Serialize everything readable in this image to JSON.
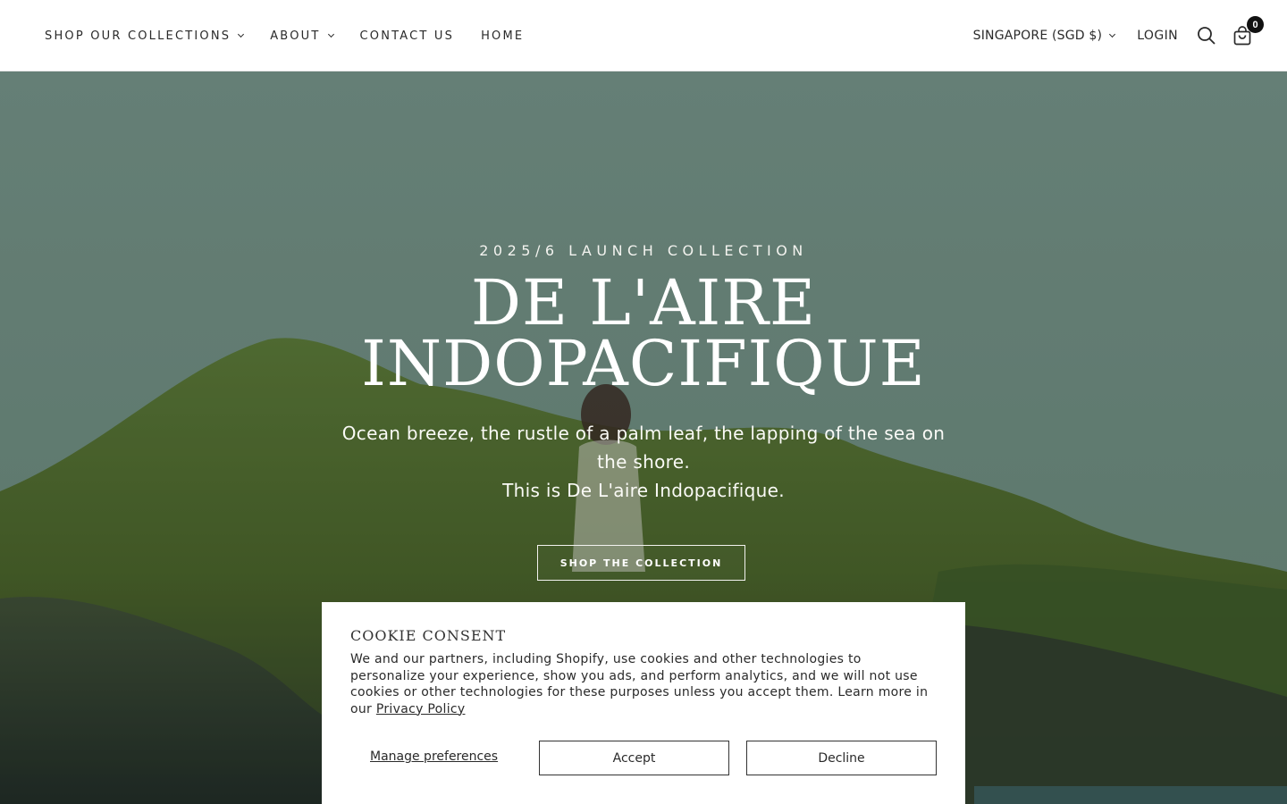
{
  "header": {
    "nav": [
      {
        "label": "SHOP OUR COLLECTIONS",
        "has_dropdown": true
      },
      {
        "label": "ABOUT",
        "has_dropdown": true
      },
      {
        "label": "CONTACT US",
        "has_dropdown": false
      },
      {
        "label": "HOME",
        "has_dropdown": false
      }
    ],
    "currency_label": "SINGAPORE (SGD $)",
    "login_label": "LOGIN",
    "search_icon": "search-icon",
    "cart_icon": "shopping-bag-icon",
    "cart_count": "0"
  },
  "hero": {
    "eyebrow": "2025/6 LAUNCH COLLECTION",
    "title_line1": "DE L'AIRE",
    "title_line2": "INDOPACIFIQUE",
    "subtitle_line1": "Ocean breeze, the rustle of a palm leaf, the lapping of the sea on the shore.",
    "subtitle_line2": "This is De L'aire Indopacifique.",
    "button_label": "SHOP THE COLLECTION"
  },
  "cookie": {
    "title": "COOKIE CONSENT",
    "text": "We and our partners, including Shopify, use cookies and other technologies to personalize your experience, show you ads, and perform analytics, and we will not use cookies or other technologies for these purposes unless you accept them. Learn more in our",
    "privacy_link": "Privacy Policy",
    "manage_label": "Manage preferences",
    "accept_label": "Accept",
    "decline_label": "Decline"
  },
  "colors": {
    "sky": "#6f8f80",
    "hill": "#4f6a2f",
    "cookie_bg": "#ffffff",
    "text": "#2a2a2a"
  }
}
